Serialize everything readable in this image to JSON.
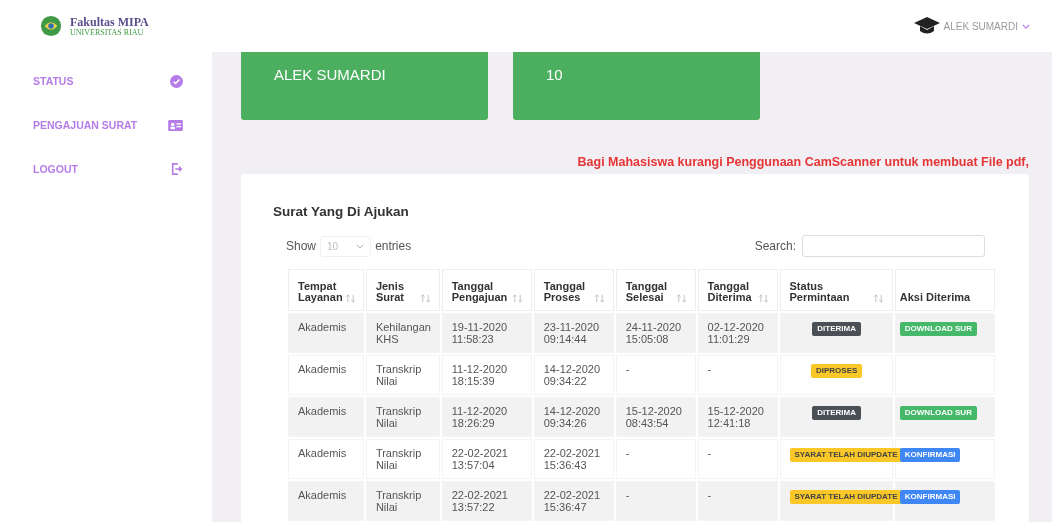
{
  "brand": {
    "title": "Fakultas MIPA",
    "subtitle": "UNIVERSITAS RIAU"
  },
  "user": {
    "name": "ALEK SUMARDI"
  },
  "sidebar": {
    "items": [
      {
        "label": "STATUS"
      },
      {
        "label": "PENGAJUAN SURAT"
      },
      {
        "label": "LOGOUT"
      }
    ]
  },
  "cards": [
    {
      "value": "ALEK SUMARDI"
    },
    {
      "value": "10"
    }
  ],
  "notice": "Bagi Mahasiswa kurangi Penggunaan CamScanner untuk membuat File pdf,",
  "panel": {
    "title": "Surat Yang Di Ajukan",
    "show_label": "Show",
    "page_size": "10",
    "entries_label": "entries",
    "search_label": "Search:"
  },
  "table": {
    "columns": [
      {
        "label": "Tempat Layanan",
        "sortable": true
      },
      {
        "label": "Jenis Surat",
        "sortable": true
      },
      {
        "label": "Tanggal Pengajuan",
        "sortable": true
      },
      {
        "label": "Tanggal Proses",
        "sortable": true
      },
      {
        "label": "Tanggal Selesai",
        "sortable": true
      },
      {
        "label": "Tanggal Diterima",
        "sortable": true
      },
      {
        "label": "Status Permintaan",
        "sortable": true
      },
      {
        "label": "Aksi Diterima",
        "sortable": false
      }
    ],
    "rows": [
      {
        "cells": [
          "Akademis",
          "Kehilangan KHS",
          "19-11-2020 11:58:23",
          "23-11-2020 09:14:44",
          "24-11-2020 15:05:08",
          "02-12-2020 11:01:29"
        ],
        "status": {
          "label": "DITERIMA",
          "kind": "dark"
        },
        "action": {
          "label": "DOWNLOAD SUR",
          "kind": "download"
        }
      },
      {
        "cells": [
          "Akademis",
          "Transkrip Nilai",
          "11-12-2020 18:15:39",
          "14-12-2020 09:34:22",
          "-",
          "-"
        ],
        "status": {
          "label": "DIPROSES",
          "kind": "warning"
        }
      },
      {
        "cells": [
          "Akademis",
          "Transkrip Nilai",
          "11-12-2020 18:26:29",
          "14-12-2020 09:34:26",
          "15-12-2020 08:43:54",
          "15-12-2020 12:41:18"
        ],
        "status": {
          "label": "DITERIMA",
          "kind": "dark"
        },
        "action": {
          "label": "DOWNLOAD SUR",
          "kind": "download"
        }
      },
      {
        "cells": [
          "Akademis",
          "Transkrip Nilai",
          "22-02-2021 13:57:04",
          "22-02-2021 15:36:43",
          "-",
          "-"
        ],
        "status": {
          "label": "SYARAT TELAH DIUPDATE",
          "kind": "warning"
        },
        "action": {
          "label": "KONFIRMASI",
          "kind": "confirm"
        }
      },
      {
        "cells": [
          "Akademis",
          "Transkrip Nilai",
          "22-02-2021 13:57:22",
          "22-02-2021 15:36:47",
          "-",
          "-"
        ],
        "status": {
          "label": "SYARAT TELAH DIUPDATE",
          "kind": "warning"
        },
        "action": {
          "label": "KONFIRMASI",
          "kind": "confirm"
        }
      }
    ]
  }
}
